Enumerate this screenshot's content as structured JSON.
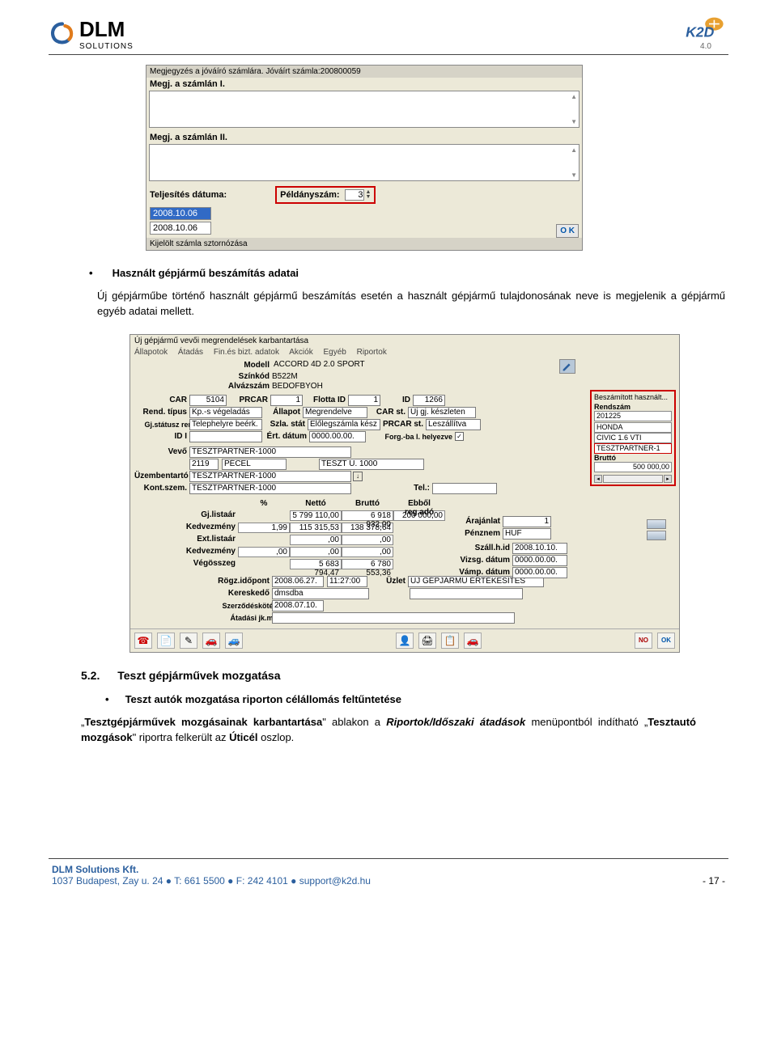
{
  "header": {
    "logo_text": "DLM",
    "logo_subtitle": "SOLUTIONS",
    "k2d_label": "K2D",
    "k2d_version": "4.0"
  },
  "invoice_panel": {
    "note_bar": "Megjegyzés a jóváíró számlára. Jóváírt számla:200800059",
    "label1": "Megj. a számlán I.",
    "label2": "Megj. a számlán II.",
    "date_label": "Teljesítés dátuma:",
    "date1": "2008.10.06",
    "date2": "2008.10.06",
    "copies_label": "Példányszám:",
    "copies_value": "3",
    "ok_label": "O K",
    "status": "Kijelölt számla sztornózása"
  },
  "body": {
    "bullet1_title": "Használt gépjármű beszámítás adatai",
    "bullet1_para": "Új gépjárműbe történő használt gépjármű beszámítás esetén a használt gépjármű tulajdonosának neve is megjelenik a gépjármű egyéb adatai mellett."
  },
  "app": {
    "title": "Új gépjármű vevői megrendelések karbantartása",
    "menu": [
      "Állapotok",
      "Átadás",
      "Fin.és bizt. adatok",
      "Akciók",
      "Egyéb",
      "Riportok"
    ],
    "modell_label": "Modell",
    "modell_val": "ACCORD 4D 2.0 SPORT",
    "szinkod_label": "Színkód",
    "szinkod_val": "B522M",
    "alvaz_label": "Alvázszám",
    "alvaz_val": "BEDOFBYOH",
    "car_label": "CAR",
    "car_val": "5104",
    "prcar_label": "PRCAR",
    "prcar_val": "1",
    "flotta_label": "Flotta ID",
    "flotta_val": "1",
    "id_label": "ID",
    "id_val": "1266",
    "rendtipus_label": "Rend. típus",
    "rendtipus_val": "Kp.-s végeladás",
    "allapot_label": "Állapot",
    "allapot_val": "Megrendelve",
    "carst_label": "CAR st.",
    "carst_val": "Új gj. készleten",
    "gjstatus_label": "Gj.státusz rend.-kor",
    "gjstatus_val": "Telephelyre beérk.",
    "szlastat_label": "Szla. stát",
    "szlastat_val": "Előlegszámla kész",
    "prcarst_label": "PRCAR st.",
    "prcarst_val": "Leszállítva",
    "idi_label": "ID I",
    "idi_val": "",
    "ertdatum_label": "Ért. dátum",
    "ertdatum_val": "0000.00.00.",
    "forg_label": "Forg.-ba l. helyezve",
    "vevo_label": "Vevő",
    "vevo_val": "TESZTPARTNER-1000",
    "vevo_code": "2119",
    "vevo_city": "PÉCEL",
    "vevo_addr": "TESZT U. 1000",
    "uzemb_label": "Üzembentartó",
    "uzemb_val": "TESZTPARTNER-1000",
    "kont_label": "Kont.szem.",
    "kont_val": "TESZTPARTNER-1000",
    "tel_label": "Tel.:",
    "sidebox": {
      "title": "Beszámított használt...",
      "rendszam_label": "Rendszám",
      "rendszam_val": "201225",
      "make": "HONDA",
      "model": "CIVIC 1.6 VTI",
      "partner": "TESZTPARTNER-1",
      "brutto_label": "Bruttó",
      "brutto_val": "500 000,00"
    },
    "price_headers": [
      "%",
      "Nettó",
      "Bruttó",
      "Ebből reg.adó"
    ],
    "price_rows": [
      {
        "label": "Gj.listaár",
        "pct": "",
        "netto": "5 799 110,00",
        "brutto": "6 918 932,00",
        "reg": "200 000,00"
      },
      {
        "label": "Kedvezmény",
        "pct": "1,99",
        "netto": "115 315,53",
        "brutto": "138 378,64",
        "reg": ""
      },
      {
        "label": "Ext.listaár",
        "pct": "",
        "netto": ",00",
        "brutto": ",00",
        "reg": ""
      },
      {
        "label": "Kedvezmény",
        "pct": ",00",
        "netto": ",00",
        "brutto": ",00",
        "reg": ""
      },
      {
        "label": "Végösszeg",
        "pct": "",
        "netto": "5 683 794,47",
        "brutto": "6 780 553,36",
        "reg": ""
      }
    ],
    "arajanlat_label": "Árajánlat",
    "arajanlat_val": "1",
    "penznem_label": "Pénznem",
    "penznem_val": "HUF",
    "szallhid_label": "Száll.h.id",
    "szallhid_val": "2008.10.10.",
    "vizsgdatum_label": "Vizsg. dátum",
    "vizsgdatum_val": "0000.00.00.",
    "vampdatum_label": "Vámp. dátum",
    "vampdatum_val": "0000.00.00.",
    "rogz_label": "Rögz.időpont",
    "rogz_date": "2008.06.27.",
    "rogz_time": "11:27:00",
    "uzlet_label": "Üzlet",
    "uzlet_val": "ÚJ GÉPJÁRMŰ ÉRTÉKESÍTÉS",
    "kereskedo_label": "Kereskedő",
    "kereskedo_val": "dmsdba",
    "szerzkotes_label": "Szerződéskötés d.",
    "szerzkotes_val": "2008.07.10.",
    "atadasi_label": "Átadási jk.megj.",
    "toolbar_buttons": [
      "🗑",
      "📄",
      "✎",
      "🚗",
      "🚙",
      "",
      "👤",
      "🖨",
      "📋",
      "🚗",
      "",
      "NO",
      "OK"
    ]
  },
  "section52": {
    "number": "5.2.",
    "title": "Teszt gépjárművek mozgatása",
    "bullet": "Teszt autók mozgatása riporton célállomás feltűntetése",
    "para_pre": "„",
    "para_b1": "Tesztgépjárművek mozgásainak karbantartása",
    "para_mid1": "\" ablakon a ",
    "para_b2": "Riportok/Időszaki átadások",
    "para_mid2": " menüpontból indítható „",
    "para_b3": "Tesztautó mozgások",
    "para_mid3": "\" riportra felkerült az ",
    "para_b4": "Úticél",
    "para_end": " oszlop."
  },
  "footer": {
    "company": "DLM Solutions Kft.",
    "address": "1037 Budapest, Zay u. 24  ●  T: 661 5500  ●  F: 242 4101  ●  support@k2d.hu",
    "page": "- 17 -"
  }
}
